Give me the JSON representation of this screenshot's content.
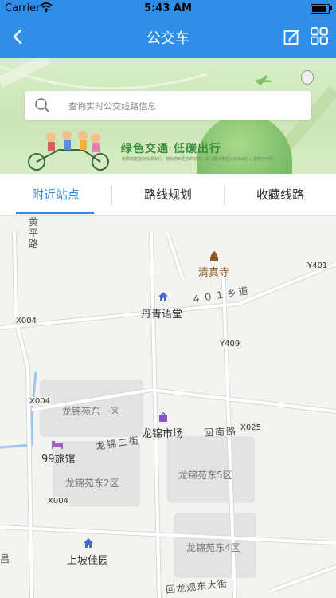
{
  "status_bar": {
    "carrier": "Carrier",
    "time": "5:43 AM"
  },
  "nav": {
    "title": "公交车"
  },
  "banner": {
    "search_placeholder": "查询实时公交线路信息",
    "slogan": "绿色交通 低碳出行",
    "slogan_sub": "如果您能坚持低碳出行，我会感到更多的快乐。出行建议乘坐公交车出行，有利于环保。"
  },
  "tabs": [
    {
      "label": "附近站点",
      "active": true
    },
    {
      "label": "路线规划",
      "active": false
    },
    {
      "label": "收藏线路",
      "active": false
    }
  ],
  "map": {
    "roads": [
      {
        "name": "黄平路"
      },
      {
        "name": "４０１乡道"
      },
      {
        "name": "龙锦二街"
      },
      {
        "name": "回南路"
      },
      {
        "name": "回龙观东大街"
      }
    ],
    "road_codes": [
      "Y401",
      "X004",
      "Y409",
      "X004",
      "X025",
      "X004"
    ],
    "areas": [
      "龙锦苑东一区",
      "龙锦苑东5区",
      "龙锦苑东2区",
      "龙锦苑东4区"
    ],
    "pois": [
      {
        "name": "清真寺",
        "icon": "mosque-icon"
      },
      {
        "name": "丹青语堂",
        "icon": "home-icon"
      },
      {
        "name": "龙锦市场",
        "icon": "shopping-bag-icon"
      },
      {
        "name": "99旅馆",
        "icon": "bed-icon"
      },
      {
        "name": "上坡佳园",
        "icon": "home-icon"
      }
    ],
    "edge_text": "昌"
  },
  "colors": {
    "accent": "#2f8fe8",
    "map_bg": "#f5f3ef",
    "block": "#e3e3e3",
    "poi_brown": "#8a5a2b"
  }
}
